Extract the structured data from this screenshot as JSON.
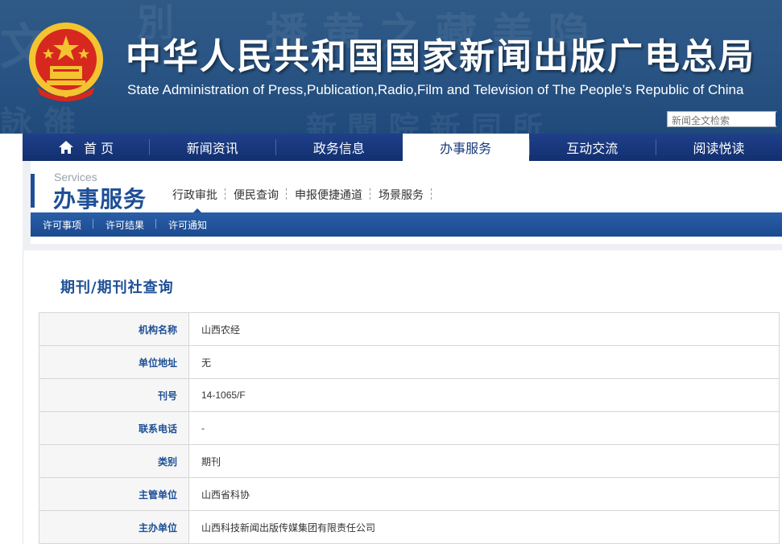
{
  "header": {
    "title_cn": "中华人民共和国国家新闻出版广电总局",
    "title_en": "State Administration of Press,Publication,Radio,Film and Television of The People’s Republic of China",
    "search_placeholder": "新闻全文检索",
    "emblem_icon": "national-emblem-icon"
  },
  "nav": {
    "items": [
      {
        "label": "首 页",
        "icon": "home-icon"
      },
      {
        "label": "新闻资讯"
      },
      {
        "label": "政务信息"
      },
      {
        "label": "办事服务",
        "active": true
      },
      {
        "label": "互动交流"
      },
      {
        "label": "阅读悦读"
      }
    ]
  },
  "section": {
    "en": "Services",
    "cn": "办事服务",
    "tabs": [
      "行政审批",
      "便民查询",
      "申报便捷通道",
      "场景服务"
    ],
    "subnav": [
      "许可事项",
      "许可结果",
      "许可通知"
    ]
  },
  "page": {
    "title": "期刊/期刊社查询",
    "rows": [
      {
        "key": "机构名称",
        "value": "山西农经"
      },
      {
        "key": "单位地址",
        "value": "无"
      },
      {
        "key": "刊号",
        "value": "14-1065/F"
      },
      {
        "key": "联系电话",
        "value": "-"
      },
      {
        "key": "类别",
        "value": "期刊"
      },
      {
        "key": "主管单位",
        "value": "山西省科协"
      },
      {
        "key": "主办单位",
        "value": "山西科技新闻出版传媒集团有限责任公司"
      }
    ]
  },
  "colors": {
    "banner": "#2a5585",
    "nav": "#1a3a7e",
    "accent": "#1d4f96",
    "emblem_red": "#d7281f",
    "emblem_gold": "#f4c430"
  }
}
